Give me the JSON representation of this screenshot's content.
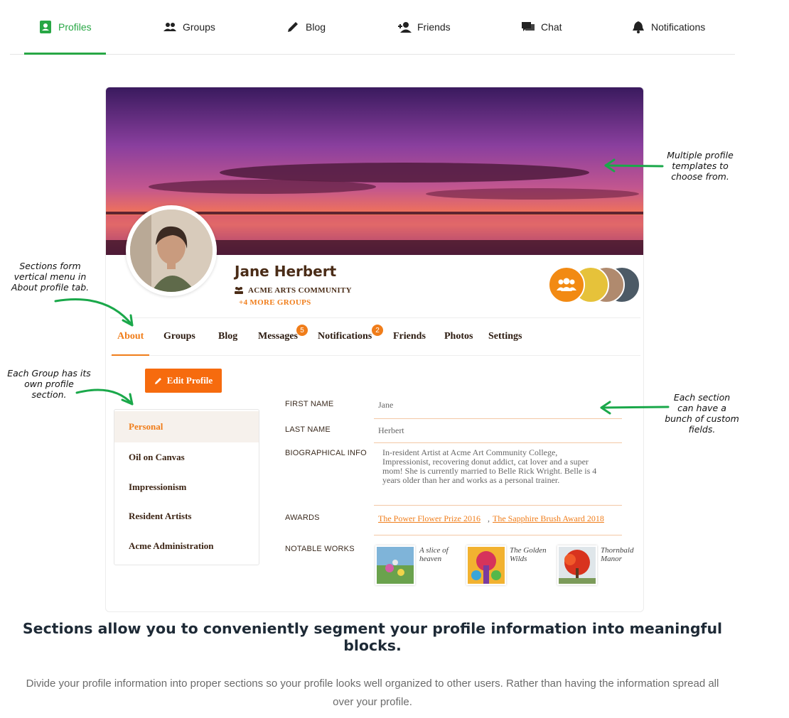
{
  "nav": {
    "items": [
      {
        "label": "Profiles",
        "icon": "profile-icon"
      },
      {
        "label": "Groups",
        "icon": "groups-icon"
      },
      {
        "label": "Blog",
        "icon": "pencil-icon"
      },
      {
        "label": "Friends",
        "icon": "add-friend-icon"
      },
      {
        "label": "Chat",
        "icon": "chat-icon"
      },
      {
        "label": "Notifications",
        "icon": "bell-icon"
      }
    ],
    "active": "Profiles"
  },
  "profile": {
    "name": "Jane Herbert",
    "group": "ACME ARTS COMMUNITY",
    "more_groups": "+4 MORE GROUPS"
  },
  "tabs": [
    {
      "label": "About"
    },
    {
      "label": "Groups"
    },
    {
      "label": "Blog"
    },
    {
      "label": "Messages",
      "badge": "5"
    },
    {
      "label": "Notifications",
      "badge": "2"
    },
    {
      "label": "Friends"
    },
    {
      "label": "Photos"
    },
    {
      "label": "Settings"
    }
  ],
  "edit_button": "Edit Profile",
  "sections": [
    "Personal",
    "Oil on Canvas",
    "Impressionism",
    "Resident Artists",
    "Acme Administration"
  ],
  "fields": {
    "first_name": {
      "label": "FIRST NAME",
      "value": "Jane"
    },
    "last_name": {
      "label": "LAST NAME",
      "value": "Herbert"
    },
    "bio": {
      "label": "BIOGRAPHICAL INFO",
      "value": "In-resident Artist at Acme Art Community College, Impressionist, recovering donut addict, cat lover and a super mom! She is currently married to Belle Rick Wright. Belle is 4 years older than her and works as a personal trainer."
    },
    "awards": {
      "label": "AWARDS",
      "items": [
        "The Power Flower Prize 2016",
        "The Sapphire Brush Award 2018"
      ],
      "separator": ","
    },
    "works": {
      "label": "NOTABLE WORKS",
      "items": [
        "A slice of heaven",
        "The Golden Wilds",
        "Thornbald Manor"
      ]
    }
  },
  "annotations": {
    "templates": "Multiple profile templates to choose from.",
    "sections_menu": "Sections form vertical menu in About profile tab.",
    "group_section": "Each Group has its own profile section.",
    "custom_fields": "Each section can have a bunch of custom fields."
  },
  "headline": "Sections allow you to conveniently segment your profile information into meaningful blocks.",
  "subtext": "Divide your profile information into proper sections so your profile looks well organized to other users. Rather than having the information spread all over your profile.",
  "colors": {
    "nav_active": "#28a745",
    "accent": "#f07d1a",
    "arrow": "#1aa84a"
  }
}
